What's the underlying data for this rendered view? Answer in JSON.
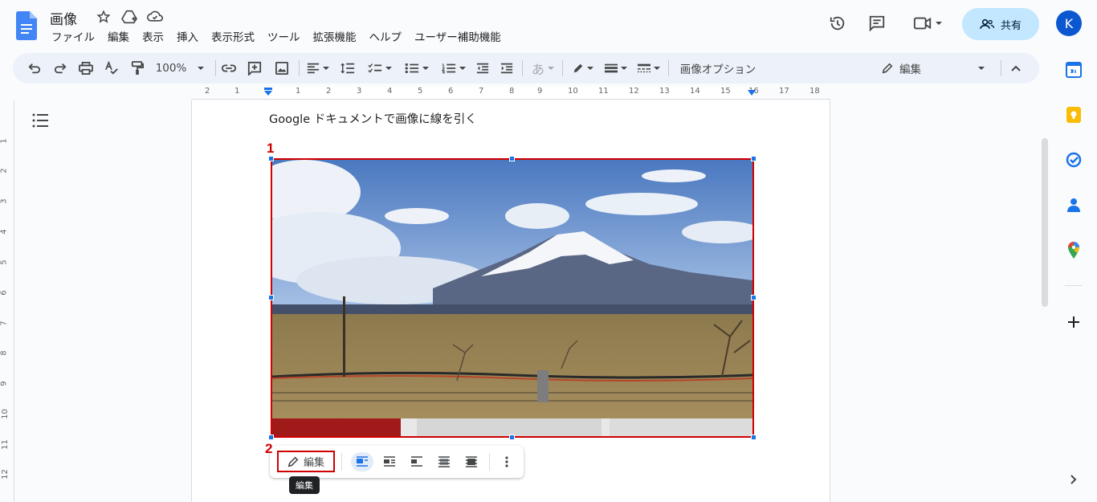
{
  "header": {
    "title": "画像",
    "menu": [
      "ファイル",
      "編集",
      "表示",
      "挿入",
      "表示形式",
      "ツール",
      "拡張機能",
      "ヘルプ",
      "ユーザー補助機能"
    ],
    "share_label": "共有",
    "avatar_initial": "K"
  },
  "toolbar": {
    "zoom": "100%",
    "image_options": "画像オプション",
    "mode_label": "編集",
    "text_style_glyph": "あ"
  },
  "ruler": {
    "labels": [
      "2",
      "1",
      "1",
      "2",
      "3",
      "4",
      "5",
      "6",
      "7",
      "8",
      "9",
      "10",
      "11",
      "12",
      "13",
      "14",
      "15",
      "16",
      "17",
      "18"
    ]
  },
  "vertical_ruler": {
    "labels": [
      "1",
      "2",
      "3",
      "4",
      "5",
      "6",
      "7",
      "8",
      "9",
      "10",
      "11",
      "12"
    ]
  },
  "document": {
    "text": "Google ドキュメントで画像に線を引く"
  },
  "annotations": {
    "marker_1": "1",
    "marker_2": "2"
  },
  "image_toolbar": {
    "edit_label": "編集",
    "tooltip": "編集"
  },
  "colors": {
    "accent": "#0b57d0",
    "share_bg": "#c2e7ff",
    "annotation_red": "#d00000",
    "selection_handle": "#1a73e8"
  }
}
